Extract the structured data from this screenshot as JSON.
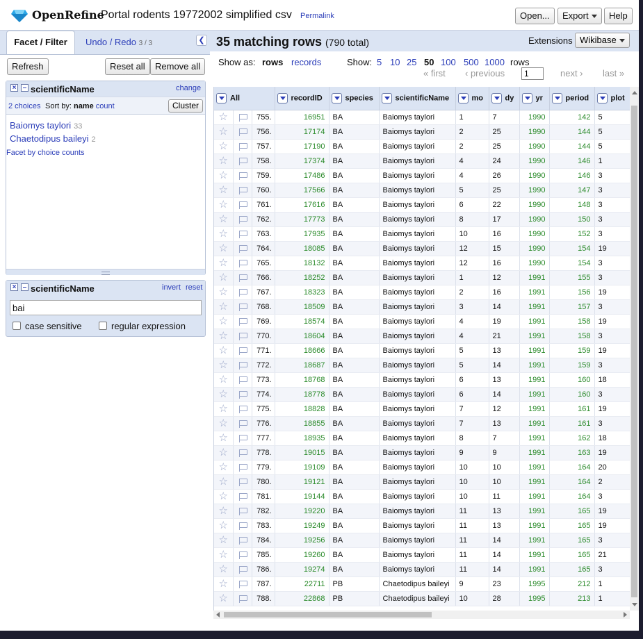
{
  "header": {
    "logo": "OpenRefine",
    "project_name": "Portal rodents 19772002 simplified csv",
    "permalink": "Permalink",
    "open_btn": "Open...",
    "export_btn": "Export",
    "help_btn": "Help"
  },
  "left_panel": {
    "tab_facet": "Facet / Filter",
    "tab_undo": "Undo / Redo",
    "undo_count": "3 / 3",
    "refresh_btn": "Refresh",
    "reset_all_btn": "Reset all",
    "remove_all_btn": "Remove all",
    "facet1": {
      "title": "scientificName",
      "change": "change",
      "choices_label": "2 choices",
      "sort_by": "Sort by:",
      "sort_name": "name",
      "sort_count": "count",
      "cluster_btn": "Cluster",
      "choices": [
        {
          "name": "Baiomys taylori",
          "count": "33"
        },
        {
          "name": "Chaetodipus baileyi",
          "count": "2"
        }
      ],
      "facet_by_counts": "Facet by choice counts"
    },
    "facet2": {
      "title": "scientificName",
      "invert": "invert",
      "reset": "reset",
      "value": "bai",
      "case_sensitive": "case sensitive",
      "regular_expression": "regular expression"
    }
  },
  "summary": {
    "matching": "35 matching rows",
    "total": "(790 total)",
    "extensions_label": "Extensions",
    "wikibase_btn": "Wikibase"
  },
  "controls": {
    "show_as": "Show as:",
    "rows": "rows",
    "records": "records",
    "show": "Show:",
    "page_sizes": [
      "5",
      "10",
      "25",
      "50",
      "100",
      "500",
      "1000"
    ],
    "rows_label": "rows",
    "first": "« first",
    "previous": "‹ previous",
    "page": "1",
    "next": "next ›",
    "last": "last »"
  },
  "columns": [
    "All",
    "recordID",
    "species",
    "scientificName",
    "mo",
    "dy",
    "yr",
    "period",
    "plot"
  ],
  "rows": [
    [
      "755.",
      "16951",
      "BA",
      "Baiomys taylori",
      "1",
      "7",
      "1990",
      "142",
      "5"
    ],
    [
      "756.",
      "17174",
      "BA",
      "Baiomys taylori",
      "2",
      "25",
      "1990",
      "144",
      "5"
    ],
    [
      "757.",
      "17190",
      "BA",
      "Baiomys taylori",
      "2",
      "25",
      "1990",
      "144",
      "5"
    ],
    [
      "758.",
      "17374",
      "BA",
      "Baiomys taylori",
      "4",
      "24",
      "1990",
      "146",
      "1"
    ],
    [
      "759.",
      "17486",
      "BA",
      "Baiomys taylori",
      "4",
      "26",
      "1990",
      "146",
      "3"
    ],
    [
      "760.",
      "17566",
      "BA",
      "Baiomys taylori",
      "5",
      "25",
      "1990",
      "147",
      "3"
    ],
    [
      "761.",
      "17616",
      "BA",
      "Baiomys taylori",
      "6",
      "22",
      "1990",
      "148",
      "3"
    ],
    [
      "762.",
      "17773",
      "BA",
      "Baiomys taylori",
      "8",
      "17",
      "1990",
      "150",
      "3"
    ],
    [
      "763.",
      "17935",
      "BA",
      "Baiomys taylori",
      "10",
      "16",
      "1990",
      "152",
      "3"
    ],
    [
      "764.",
      "18085",
      "BA",
      "Baiomys taylori",
      "12",
      "15",
      "1990",
      "154",
      "19"
    ],
    [
      "765.",
      "18132",
      "BA",
      "Baiomys taylori",
      "12",
      "16",
      "1990",
      "154",
      "3"
    ],
    [
      "766.",
      "18252",
      "BA",
      "Baiomys taylori",
      "1",
      "12",
      "1991",
      "155",
      "3"
    ],
    [
      "767.",
      "18323",
      "BA",
      "Baiomys taylori",
      "2",
      "16",
      "1991",
      "156",
      "19"
    ],
    [
      "768.",
      "18509",
      "BA",
      "Baiomys taylori",
      "3",
      "14",
      "1991",
      "157",
      "3"
    ],
    [
      "769.",
      "18574",
      "BA",
      "Baiomys taylori",
      "4",
      "19",
      "1991",
      "158",
      "19"
    ],
    [
      "770.",
      "18604",
      "BA",
      "Baiomys taylori",
      "4",
      "21",
      "1991",
      "158",
      "3"
    ],
    [
      "771.",
      "18666",
      "BA",
      "Baiomys taylori",
      "5",
      "13",
      "1991",
      "159",
      "19"
    ],
    [
      "772.",
      "18687",
      "BA",
      "Baiomys taylori",
      "5",
      "14",
      "1991",
      "159",
      "3"
    ],
    [
      "773.",
      "18768",
      "BA",
      "Baiomys taylori",
      "6",
      "13",
      "1991",
      "160",
      "18"
    ],
    [
      "774.",
      "18778",
      "BA",
      "Baiomys taylori",
      "6",
      "14",
      "1991",
      "160",
      "3"
    ],
    [
      "775.",
      "18828",
      "BA",
      "Baiomys taylori",
      "7",
      "12",
      "1991",
      "161",
      "19"
    ],
    [
      "776.",
      "18855",
      "BA",
      "Baiomys taylori",
      "7",
      "13",
      "1991",
      "161",
      "3"
    ],
    [
      "777.",
      "18935",
      "BA",
      "Baiomys taylori",
      "8",
      "7",
      "1991",
      "162",
      "18"
    ],
    [
      "778.",
      "19015",
      "BA",
      "Baiomys taylori",
      "9",
      "9",
      "1991",
      "163",
      "19"
    ],
    [
      "779.",
      "19109",
      "BA",
      "Baiomys taylori",
      "10",
      "10",
      "1991",
      "164",
      "20"
    ],
    [
      "780.",
      "19121",
      "BA",
      "Baiomys taylori",
      "10",
      "10",
      "1991",
      "164",
      "2"
    ],
    [
      "781.",
      "19144",
      "BA",
      "Baiomys taylori",
      "10",
      "11",
      "1991",
      "164",
      "3"
    ],
    [
      "782.",
      "19220",
      "BA",
      "Baiomys taylori",
      "11",
      "13",
      "1991",
      "165",
      "19"
    ],
    [
      "783.",
      "19249",
      "BA",
      "Baiomys taylori",
      "11",
      "13",
      "1991",
      "165",
      "19"
    ],
    [
      "784.",
      "19256",
      "BA",
      "Baiomys taylori",
      "11",
      "14",
      "1991",
      "165",
      "3"
    ],
    [
      "785.",
      "19260",
      "BA",
      "Baiomys taylori",
      "11",
      "14",
      "1991",
      "165",
      "21"
    ],
    [
      "786.",
      "19274",
      "BA",
      "Baiomys taylori",
      "11",
      "14",
      "1991",
      "165",
      "3"
    ],
    [
      "787.",
      "22711",
      "PB",
      "Chaetodipus baileyi",
      "9",
      "23",
      "1995",
      "212",
      "1"
    ],
    [
      "788.",
      "22868",
      "PB",
      "Chaetodipus baileyi",
      "10",
      "28",
      "1995",
      "213",
      "1"
    ]
  ],
  "colors": {
    "accent_blue": "#2a3cb8",
    "panel_bg": "#dbe4f3",
    "numeric_green": "#2a8a2a"
  },
  "icons": {
    "logo": "diamond-gem-icon",
    "row_star": "star-icon",
    "row_flag": "flag-icon",
    "column_menu": "chevron-down-icon"
  }
}
